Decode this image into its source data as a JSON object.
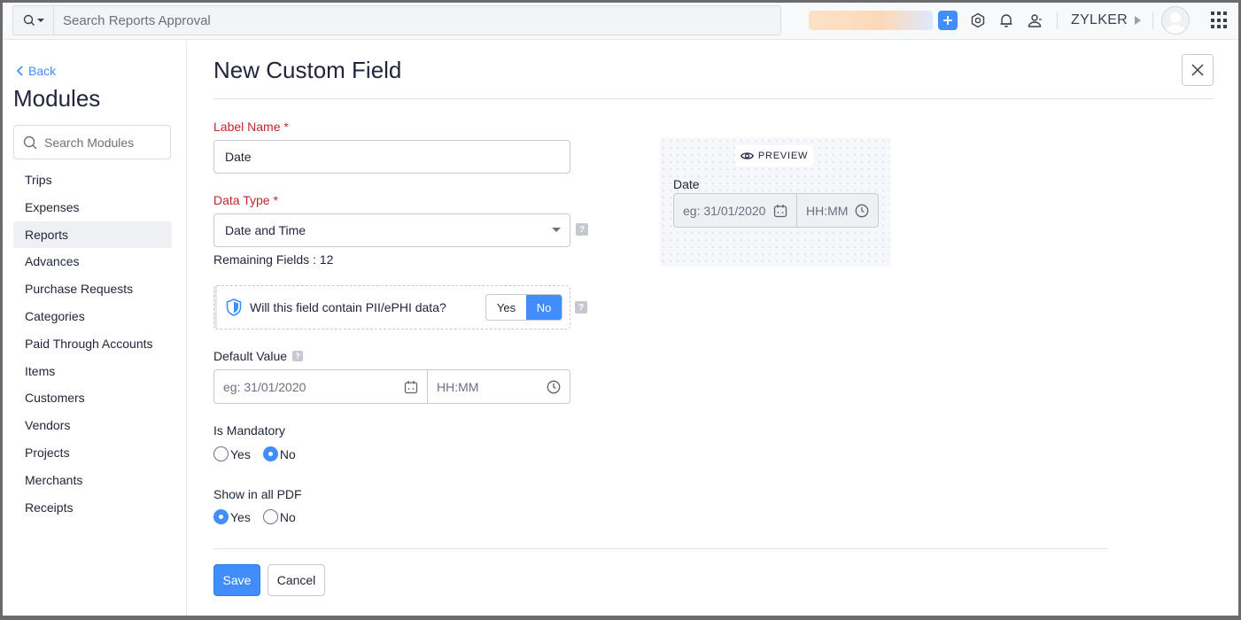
{
  "topbar": {
    "search_placeholder": "Search Reports Approval",
    "org_name": "ZYLKER",
    "icons": [
      "search-icon",
      "plus-icon",
      "gear-icon",
      "bell-icon",
      "users-icon",
      "avatar",
      "apps-grid-icon"
    ]
  },
  "sidebar": {
    "back_label": "Back",
    "title": "Modules",
    "search_placeholder": "Search Modules",
    "items": [
      {
        "label": "Trips"
      },
      {
        "label": "Expenses"
      },
      {
        "label": "Reports",
        "active": true
      },
      {
        "label": "Advances"
      },
      {
        "label": "Purchase Requests"
      },
      {
        "label": "Categories"
      },
      {
        "label": "Paid Through Accounts"
      },
      {
        "label": "Items"
      },
      {
        "label": "Customers"
      },
      {
        "label": "Vendors"
      },
      {
        "label": "Projects"
      },
      {
        "label": "Merchants"
      },
      {
        "label": "Receipts"
      }
    ]
  },
  "form": {
    "title": "New Custom Field",
    "label_name": {
      "label": "Label Name *",
      "value": "Date"
    },
    "data_type": {
      "label": "Data Type *",
      "value": "Date and Time"
    },
    "remaining_fields": "Remaining Fields : 12",
    "pii": {
      "question": "Will this field contain PII/ePHI data?",
      "yes": "Yes",
      "no": "No",
      "selected": "No"
    },
    "default_value": {
      "label": "Default Value",
      "date_placeholder": "eg: 31/01/2020",
      "time_placeholder": "HH:MM"
    },
    "is_mandatory": {
      "label": "Is Mandatory",
      "yes": "Yes",
      "no": "No",
      "selected": "No"
    },
    "show_in_pdf": {
      "label": "Show in all PDF",
      "yes": "Yes",
      "no": "No",
      "selected": "Yes"
    },
    "save_label": "Save",
    "cancel_label": "Cancel",
    "help_glyph": "?"
  },
  "preview": {
    "badge": "PREVIEW",
    "field_label": "Date",
    "date_placeholder": "eg: 31/01/2020",
    "time_placeholder": "HH:MM"
  },
  "colors": {
    "accent": "#408dfb",
    "required": "#c4262e"
  }
}
